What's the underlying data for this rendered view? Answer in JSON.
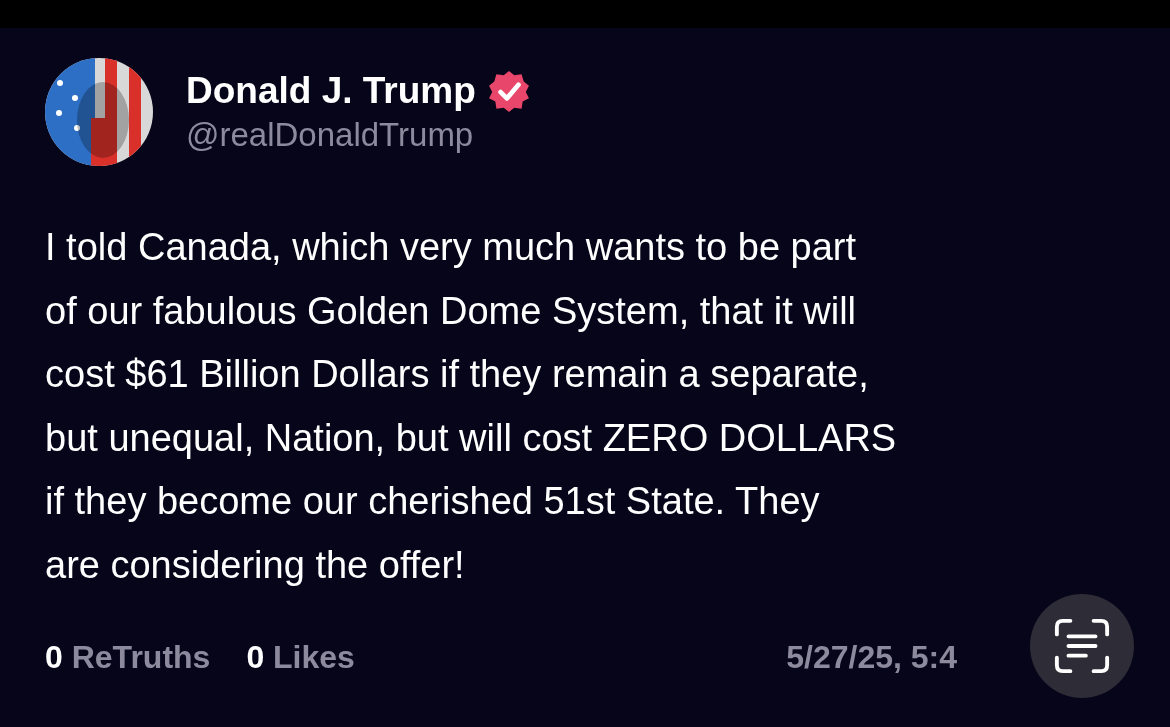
{
  "post": {
    "author": {
      "name": "Donald J. Trump",
      "handle": "@realDonaldTrump",
      "verified": true
    },
    "text": "I told Canada, which very much wants to be part\nof our fabulous Golden Dome System, that it will\ncost $61 Billion Dollars if they remain a separate,\nbut unequal, Nation, but will cost ZERO DOLLARS\nif they become our cherished 51st State. They\nare considering the offer!",
    "stats": [
      {
        "count": "0",
        "label": "ReTruths"
      },
      {
        "count": "0",
        "label": "Likes"
      }
    ],
    "timestamp": "5/27/25, 5:4"
  }
}
